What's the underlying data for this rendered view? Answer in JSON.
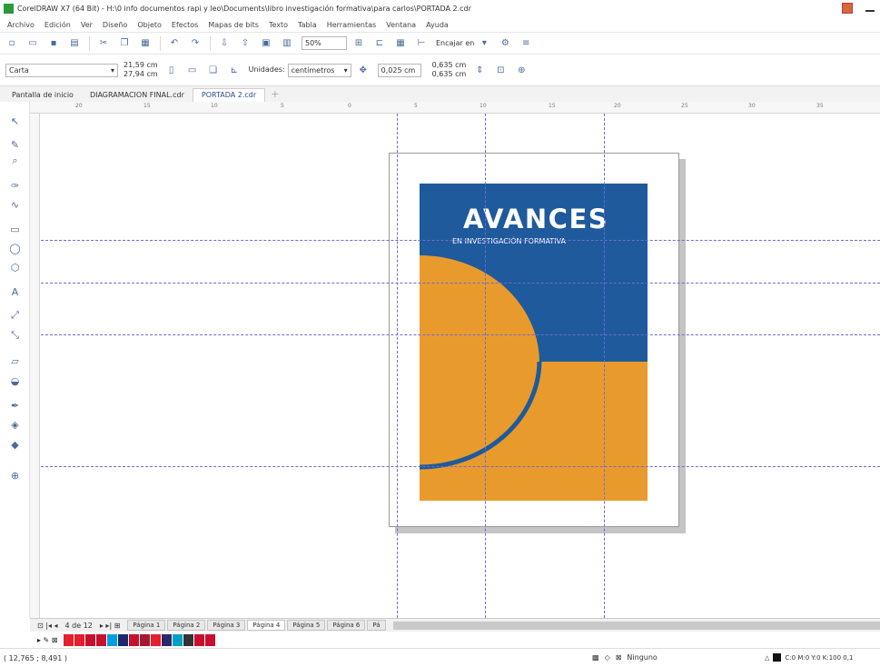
{
  "window": {
    "title": "CorelDRAW X7 (64 Bit) - H:\\0 info documentos rapi y leo\\Documents\\libro investigación formativa\\para carlos\\PORTADA 2.cdr"
  },
  "menu": [
    "Archivo",
    "Edición",
    "Ver",
    "Diseño",
    "Objeto",
    "Efectos",
    "Mapas de bits",
    "Texto",
    "Tabla",
    "Herramientas",
    "Ventana",
    "Ayuda"
  ],
  "toolbar": {
    "zoom": "50%",
    "snap_label": "Encajar en"
  },
  "propbar": {
    "paper": "Carta",
    "width": "21,59 cm",
    "height": "27,94 cm",
    "units_label": "Unidades:",
    "units_value": "centímetros",
    "nudge": "0,025 cm",
    "dup_x": "0,635 cm",
    "dup_y": "0,635 cm"
  },
  "tabs": [
    "Pantalla de inicio",
    "DIAGRAMACION FINAL.cdr",
    "PORTADA 2.cdr",
    "+"
  ],
  "ruler_h": [
    "20",
    "15",
    "10",
    "5",
    "0",
    "5",
    "10",
    "15",
    "20",
    "25",
    "30",
    "35"
  ],
  "cover": {
    "title": "AVANCES",
    "subtitle": "EN INVESTIGACIÓN FORMATIVA",
    "colors": {
      "blue": "#1e5a9c",
      "orange": "#e89b2c"
    }
  },
  "pages": {
    "indicator": "4 de 12",
    "tabs": [
      "Página 1",
      "Página 2",
      "Página 3",
      "Página 4",
      "Página 5",
      "Página 6",
      "Pá"
    ],
    "active_index": 3
  },
  "palette": [
    "#e61e2d",
    "#e61e2d",
    "#c8102e",
    "#c8102e",
    "#009ee0",
    "#1a2a6c",
    "#c8102e",
    "#a6192e",
    "#e61e2d",
    "#2a2a6a",
    "#00a0c6",
    "#333333",
    "#c8102e",
    "#c8102e"
  ],
  "status": {
    "coords": "( 12,765 ; 8,491 )",
    "fill_label": "Ninguno",
    "color_info": "C:0 M:0 Y:0 K:100  0,1"
  }
}
